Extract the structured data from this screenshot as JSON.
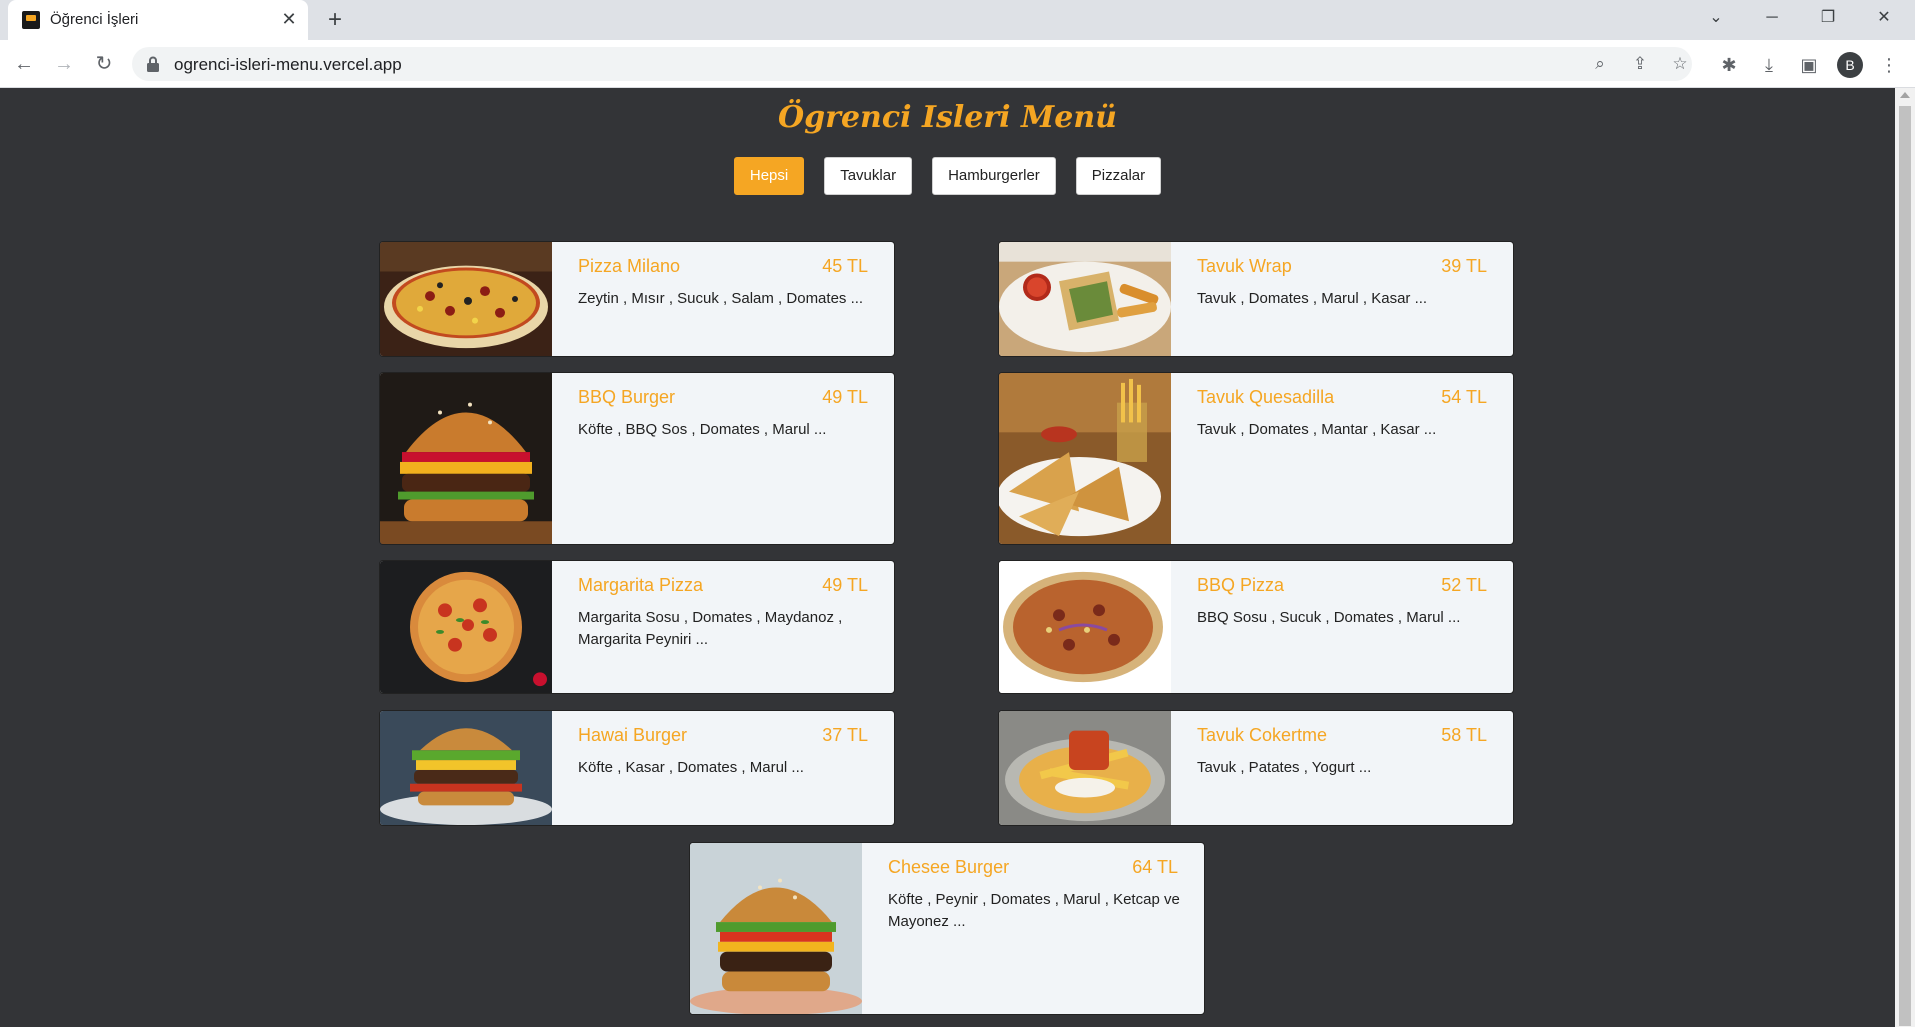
{
  "browser": {
    "tab_title": "Öğrenci İşleri",
    "new_tab": "+",
    "url": "ogrenci-isleri-menu.vercel.app",
    "profile_initial": "B"
  },
  "page": {
    "title": "Ögrenci Isleri Menü",
    "filters": [
      "Hepsi",
      "Tavuklar",
      "Hamburgerler",
      "Pizzalar"
    ],
    "active_filter": "Hepsi",
    "accent_color": "#f5a623"
  },
  "menu": [
    {
      "name": "Pizza Milano",
      "price": "45 TL",
      "desc": "Zeytin , Mısır , Sucuk , Salam , Domates ..."
    },
    {
      "name": "Tavuk Wrap",
      "price": "39 TL",
      "desc": "Tavuk , Domates , Marul , Kasar ..."
    },
    {
      "name": "BBQ Burger",
      "price": "49 TL",
      "desc": "Köfte , BBQ Sos , Domates , Marul ..."
    },
    {
      "name": "Tavuk Quesadilla",
      "price": "54 TL",
      "desc": "Tavuk , Domates , Mantar , Kasar ..."
    },
    {
      "name": "Margarita Pizza",
      "price": "49 TL",
      "desc": "Margarita Sosu , Domates , Maydanoz , Margarita Peyniri ..."
    },
    {
      "name": "BBQ Pizza",
      "price": "52 TL",
      "desc": "BBQ Sosu , Sucuk , Domates , Marul ..."
    },
    {
      "name": "Hawai Burger",
      "price": "37 TL",
      "desc": "Köfte , Kasar , Domates , Marul ..."
    },
    {
      "name": "Tavuk Cokertme",
      "price": "58 TL",
      "desc": "Tavuk , Patates , Yogurt ..."
    },
    {
      "name": "Chesee Burger",
      "price": "64 TL",
      "desc": "Köfte , Peynir , Domates , Marul , Ketcap ve Mayonez ..."
    }
  ]
}
